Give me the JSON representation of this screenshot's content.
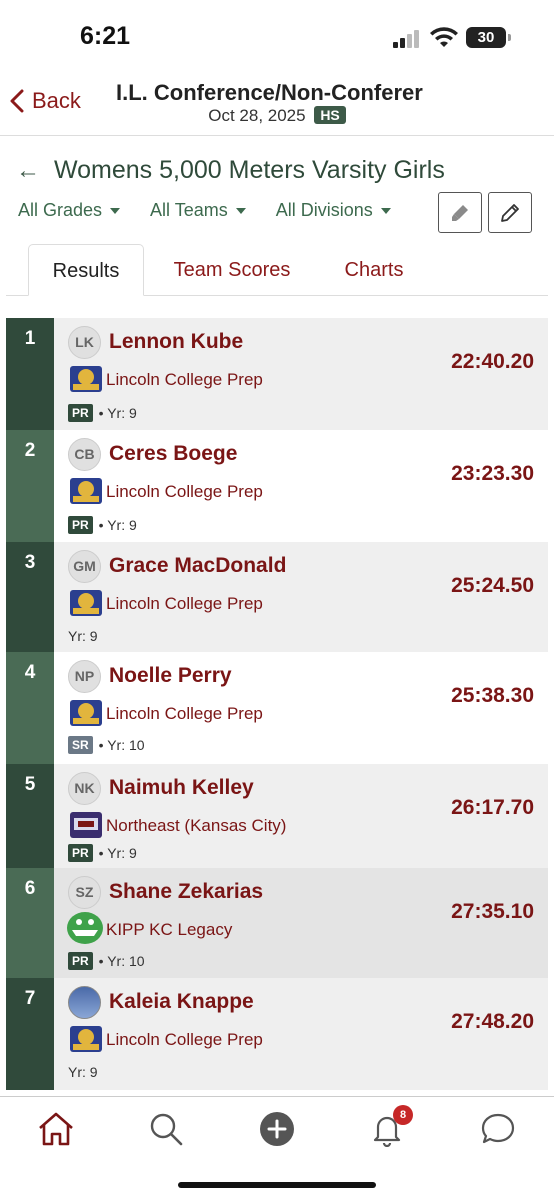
{
  "status_bar": {
    "time": "6:21",
    "battery": "30"
  },
  "nav": {
    "back_label": "Back",
    "title": "I.L. Conference/Non-Conferer",
    "date": "Oct 28, 2025",
    "level_badge": "HS"
  },
  "event": {
    "title": "Womens 5,000 Meters Varsity Girls"
  },
  "filters": {
    "grades": "All Grades",
    "teams": "All Teams",
    "divisions": "All Divisions"
  },
  "tabs": [
    {
      "label": "Results",
      "active": true
    },
    {
      "label": "Team Scores",
      "active": false
    },
    {
      "label": "Charts",
      "active": false
    }
  ],
  "results": [
    {
      "place": "1",
      "initials": "LK",
      "name": "Lennon Kube",
      "school": "Lincoln College Prep",
      "tag": "PR",
      "year": "• Yr: 9",
      "mark": "22:40.20"
    },
    {
      "place": "2",
      "initials": "CB",
      "name": "Ceres Boege",
      "school": "Lincoln College Prep",
      "tag": "PR",
      "year": "• Yr: 9",
      "mark": "23:23.30"
    },
    {
      "place": "3",
      "initials": "GM",
      "name": "Grace MacDonald",
      "school": "Lincoln College Prep",
      "tag": "",
      "year": "Yr: 9",
      "mark": "25:24.50"
    },
    {
      "place": "4",
      "initials": "NP",
      "name": "Noelle Perry",
      "school": "Lincoln College Prep",
      "tag": "SR",
      "year": "• Yr: 10",
      "mark": "25:38.30"
    },
    {
      "place": "5",
      "initials": "NK",
      "name": "Naimuh Kelley",
      "school": "Northeast (Kansas City)",
      "tag": "PR",
      "year": "• Yr: 9",
      "mark": "26:17.70"
    },
    {
      "place": "6",
      "initials": "SZ",
      "name": "Shane Zekarias",
      "school": "KIPP KC Legacy",
      "tag": "PR",
      "year": "• Yr: 10",
      "mark": "27:35.10"
    },
    {
      "place": "7",
      "initials": "",
      "name": "Kaleia Knappe",
      "school": "Lincoln College Prep",
      "tag": "",
      "year": "Yr: 9",
      "mark": "27:48.20"
    }
  ],
  "bottom_nav": {
    "notifications_count": "8"
  },
  "colors": {
    "brand_red": "#7a1515",
    "brand_green": "#304a3b"
  },
  "icons": [
    "back-chevron-icon",
    "highlighter-icon",
    "pencil-icon",
    "home-icon",
    "search-icon",
    "plus-icon",
    "bell-icon",
    "chat-icon"
  ]
}
